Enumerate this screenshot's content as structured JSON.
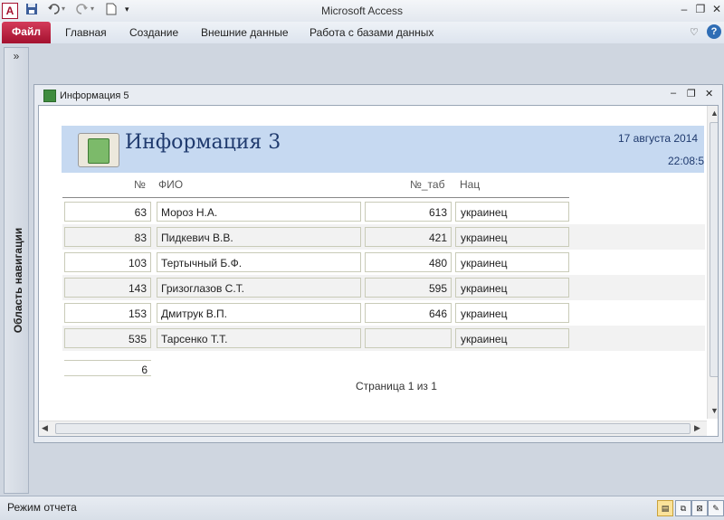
{
  "window": {
    "title": "Microsoft Access",
    "quick_access": [
      "save-icon",
      "undo-icon",
      "redo-icon",
      "new-document-icon",
      "customize-toolbar-icon"
    ],
    "controls": [
      "minimize-icon",
      "restore-icon",
      "close-icon"
    ]
  },
  "ribbon": {
    "file_tab": "Файл",
    "tabs": [
      "Главная",
      "Создание",
      "Внешние данные",
      "Работа с базами данных"
    ]
  },
  "nav_pane": {
    "collapse_glyph": "»",
    "label": "Область навигации"
  },
  "document": {
    "title": "Информация 5",
    "report": {
      "title": "Информация 3",
      "date": "17 августа 2014",
      "time": "22:08:5",
      "headers": {
        "num": "№",
        "fio": "ФИО",
        "tab": "№_таб",
        "nat": "Нац"
      },
      "rows": [
        {
          "num": "63",
          "fio": "Мороз Н.А.",
          "tab": "613",
          "nat": "украинец"
        },
        {
          "num": "83",
          "fio": "Пидкевич В.В.",
          "tab": "421",
          "nat": "украинец"
        },
        {
          "num": "103",
          "fio": "Тертычный Б.Ф.",
          "tab": "480",
          "nat": "украинец"
        },
        {
          "num": "143",
          "fio": "Гризоглазов С.Т.",
          "tab": "595",
          "nat": "украинец"
        },
        {
          "num": "153",
          "fio": "Дмитрук В.П.",
          "tab": "646",
          "nat": "украинец"
        },
        {
          "num": "535",
          "fio": "Тарсенко Т.Т.",
          "tab": "",
          "nat": "украинец"
        }
      ],
      "count": "6",
      "page_footer": "Страница 1 из 1"
    }
  },
  "statusbar": {
    "text": "Режим отчета"
  },
  "colors": {
    "file_tab": "#b4193a",
    "report_header": "#c6d9f1",
    "report_title": "#1f3a6e"
  }
}
